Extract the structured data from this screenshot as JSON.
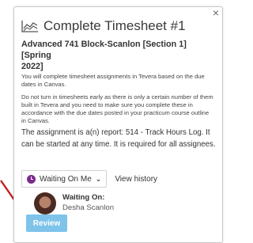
{
  "card": {
    "close_glyph": "×",
    "title": "Complete Timesheet #1",
    "subtitle_line1": "Advanced 741 Block-Scanlon [Section 1] [Spring",
    "subtitle_line2": "2022]",
    "description_1": "You will complete timesheet assignments in Tevera based on the due dates in Canvas.",
    "description_2": "Do not turn in timesheets early as there is only a certain number of them built in Tevera and you need to make sure you complete these in accordance with the due dates posted in your practicum course outline in Canvas.",
    "info": "The assignment is a(n) report: 514 - Track Hours Log. It can be started at any time. It is required for all assignees."
  },
  "actions": {
    "waiting_label": "Waiting On Me",
    "history_label": "View history"
  },
  "assignee": {
    "label": "Waiting On:",
    "name": "Desha Scanlon"
  },
  "review_button": "Review",
  "icons": {
    "title": "chart-line-icon",
    "waiting": "clock-icon",
    "dropdown": "chevron-down-icon",
    "close": "close-icon",
    "annotation": "red-arrow-annotation"
  },
  "colors": {
    "review_button": "#7ec3ea",
    "clock_icon": "#7a2b8e",
    "annotation_arrow": "#c0221d"
  }
}
